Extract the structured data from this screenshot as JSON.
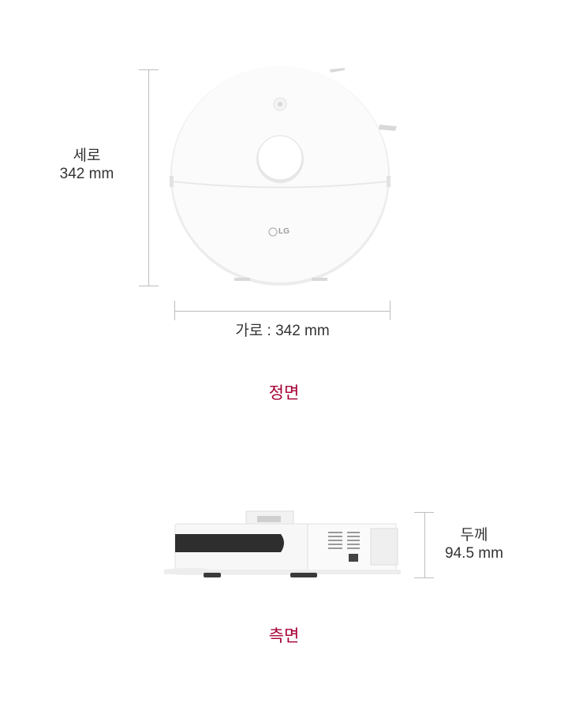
{
  "front": {
    "height_label": "세로",
    "height_value": "342 mm",
    "width_label": "가로 : 342 mm",
    "logo_text": "LG",
    "caption": "정면"
  },
  "side": {
    "thickness_label": "두께",
    "thickness_value": "94.5 mm",
    "caption": "측면"
  },
  "colors": {
    "accent": "#a50034",
    "dimension_line": "#bdbdbd",
    "text": "#333333"
  }
}
